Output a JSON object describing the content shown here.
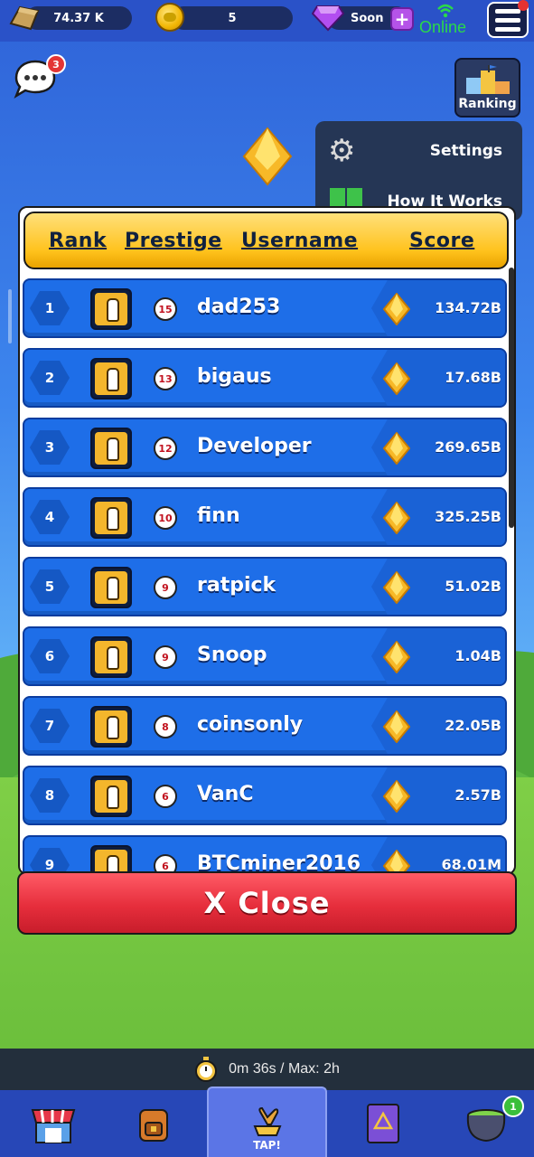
{
  "top_bar": {
    "gold_value": "74.37 K",
    "coin_value": "5",
    "gem_value": "Soon",
    "plus_label": "+",
    "connection_status": "Online"
  },
  "chat": {
    "badge_count": "3"
  },
  "ranking_button": {
    "label": "Ranking"
  },
  "side_menu": {
    "items": [
      {
        "label": "Settings",
        "icon": "gear-icon"
      },
      {
        "label": "How It Works",
        "icon": "book-icon"
      }
    ]
  },
  "leaderboard": {
    "headers": {
      "rank": "Rank",
      "prestige": "Prestige",
      "username": "Username",
      "score": "Score"
    },
    "rows": [
      {
        "rank": "1",
        "prestige": "15",
        "username": "dad253",
        "score": "134.72B"
      },
      {
        "rank": "2",
        "prestige": "13",
        "username": "bigaus",
        "score": "17.68B"
      },
      {
        "rank": "3",
        "prestige": "12",
        "username": "Developer",
        "score": "269.65B"
      },
      {
        "rank": "4",
        "prestige": "10",
        "username": "finn",
        "score": "325.25B"
      },
      {
        "rank": "5",
        "prestige": "9",
        "username": "ratpick",
        "score": "51.02B"
      },
      {
        "rank": "6",
        "prestige": "9",
        "username": "Snoop",
        "score": "1.04B"
      },
      {
        "rank": "7",
        "prestige": "8",
        "username": "coinsonly",
        "score": "22.05B"
      },
      {
        "rank": "8",
        "prestige": "6",
        "username": "VanC",
        "score": "2.57B"
      },
      {
        "rank": "9",
        "prestige": "6",
        "username": "BTCminer2016",
        "score": "68.01M"
      }
    ],
    "close_label": "X Close"
  },
  "timer": {
    "text": "0m 36s / Max: 2h"
  },
  "bottom_nav": {
    "tap_label": "TAP!",
    "cauldron_badge": "1"
  },
  "colors": {
    "row_blue": "#1e6ee8",
    "header_gold": "#ffc21c",
    "close_red": "#e62e3c",
    "online_green": "#2ad94a"
  }
}
